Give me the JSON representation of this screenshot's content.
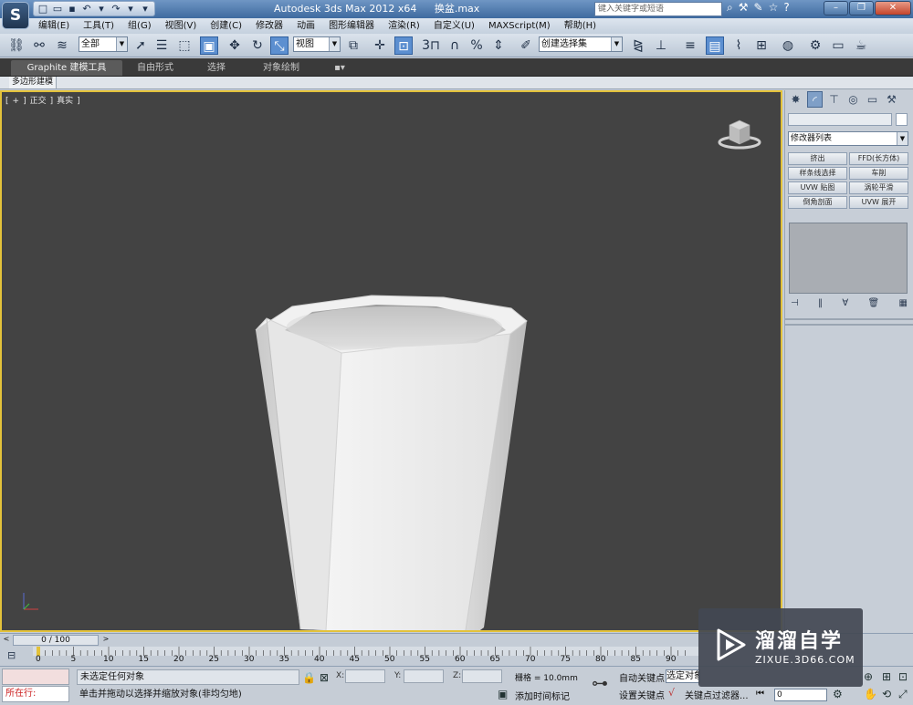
{
  "titlebar": {
    "app": "Autodesk 3ds Max  2012 x64",
    "file": "换盆.max",
    "search_placeholder": "键入关键字或短语"
  },
  "menu": [
    "编辑(E)",
    "工具(T)",
    "组(G)",
    "视图(V)",
    "创建(C)",
    "修改器",
    "动画",
    "图形编辑器",
    "渲染(R)",
    "自定义(U)",
    "MAXScript(M)",
    "帮助(H)"
  ],
  "toolbar": {
    "selection_filter": "全部",
    "ref_coord": "视图",
    "named_selection": "创建选择集",
    "snap_label": "3"
  },
  "ribbon": {
    "tabs": [
      "Graphite 建模工具",
      "自由形式",
      "选择",
      "对象绘制"
    ],
    "subtab": "多边形建模"
  },
  "viewport": {
    "label_parts": [
      "[",
      "+",
      "]",
      "正交",
      "]",
      "真实",
      "]"
    ]
  },
  "command_panel": {
    "modifier_list": "修改器列表",
    "buttons": [
      "挤出",
      "FFD(长方体)",
      "样条线选择",
      "车削",
      "UVW 贴图",
      "涡轮平滑",
      "倒角剖面",
      "UVW 展开"
    ]
  },
  "timeslider": {
    "frame_text": "0 / 100"
  },
  "trackbar": {
    "ticks": [
      "0",
      "5",
      "10",
      "15",
      "20",
      "25",
      "30",
      "35",
      "40",
      "45",
      "50",
      "55",
      "60",
      "65",
      "70",
      "75",
      "80",
      "85",
      "90"
    ]
  },
  "status": {
    "script_label": "所在行:",
    "selection_text": "未选定任何对象",
    "prompt_text": "单击并拖动以选择并缩放对象(非均匀地)",
    "x_label": "X:",
    "y_label": "Y:",
    "z_label": "Z:",
    "grid_text": "栅格 = 10.0mm",
    "add_time_tag": "添加时间标记",
    "auto_key": "自动关键点",
    "set_key": "设置关键点",
    "selected_obj": "选定对象",
    "key_filter": "关键点过滤器...",
    "frame": "0"
  },
  "watermark": {
    "title": "溜溜自学",
    "subtitle": "ZIXUE.3D66.COM"
  },
  "colors": {
    "viewport_bg": "#434343",
    "viewport_border": "#e3c23a",
    "titlebar": "#4e7bb0"
  }
}
